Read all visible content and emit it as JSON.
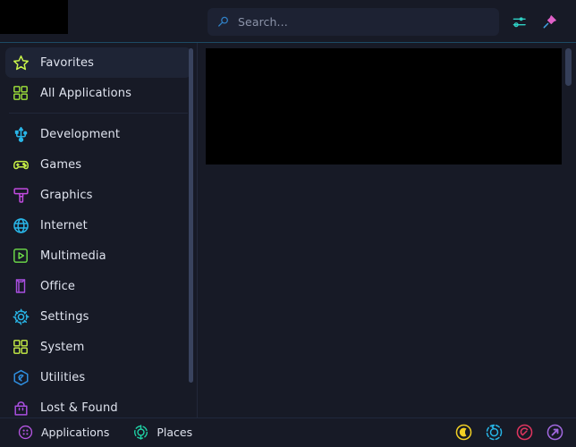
{
  "window": {
    "title": "Application Launcher",
    "background_color": "#171a26",
    "accent_color": "#1d4a63"
  },
  "topbar": {
    "user_area": {
      "name": "user-avatar-redacted",
      "redacted": true
    },
    "search": {
      "icon": "search-icon",
      "placeholder": "Search...",
      "value": "",
      "icon_color": "#2f7fc4"
    },
    "actions": [
      {
        "name": "configure-icon",
        "label": "Configure",
        "color": "#2fd0c4"
      },
      {
        "name": "pin-icon",
        "label": "Pin Window",
        "color": "#e061c8"
      }
    ]
  },
  "sidebar": {
    "scroll": {
      "thumb_color": "#39435e"
    },
    "items": [
      {
        "label": "Favorites",
        "icon": "star-icon",
        "color": "#c9f54a",
        "selected": true,
        "separator_after": false
      },
      {
        "label": "All Applications",
        "icon": "grid-icon",
        "color": "#9fe33a",
        "selected": false,
        "separator_after": true
      },
      {
        "label": "Development",
        "icon": "usb-icon",
        "color": "#29b6e8",
        "selected": false,
        "separator_after": false
      },
      {
        "label": "Games",
        "icon": "gamepad-icon",
        "color": "#c8f046",
        "selected": false,
        "separator_after": false
      },
      {
        "label": "Graphics",
        "icon": "paintbrush-icon",
        "color": "#c24be0",
        "selected": false,
        "separator_after": false
      },
      {
        "label": "Internet",
        "icon": "globe-icon",
        "color": "#29b6e8",
        "selected": false,
        "separator_after": false
      },
      {
        "label": "Multimedia",
        "icon": "play-icon",
        "color": "#6fe04a",
        "selected": false,
        "separator_after": false
      },
      {
        "label": "Office",
        "icon": "book-icon",
        "color": "#a94fe0",
        "selected": false,
        "separator_after": false
      },
      {
        "label": "Settings",
        "icon": "gear-icon",
        "color": "#29b6e8",
        "selected": false,
        "separator_after": false
      },
      {
        "label": "System",
        "icon": "grid-icon",
        "color": "#c8f046",
        "selected": false,
        "separator_after": false
      },
      {
        "label": "Utilities",
        "icon": "wrench-icon",
        "color": "#2f8fe0",
        "selected": false,
        "separator_after": false
      },
      {
        "label": "Lost & Found",
        "icon": "bag-icon",
        "color": "#a94fe0",
        "selected": false,
        "separator_after": true
      }
    ]
  },
  "main": {
    "content": {
      "name": "app-list-redacted",
      "redacted": true
    },
    "scroll": {
      "thumb_color": "#353f59"
    }
  },
  "bottombar": {
    "tabs": [
      {
        "label": "Applications",
        "icon": "applications-icon",
        "color": "#b455e0"
      },
      {
        "label": "Places",
        "icon": "places-icon",
        "color": "#1fd6a8"
      }
    ],
    "power_actions": [
      {
        "name": "suspend-icon",
        "label": "Suspend",
        "color": "#f2d024"
      },
      {
        "name": "restart-icon",
        "label": "Restart",
        "color": "#27b6e8"
      },
      {
        "name": "shutdown-icon",
        "label": "Shut Down",
        "color": "#e0355f"
      },
      {
        "name": "logout-icon",
        "label": "Log Out",
        "color": "#a268e0"
      }
    ]
  }
}
